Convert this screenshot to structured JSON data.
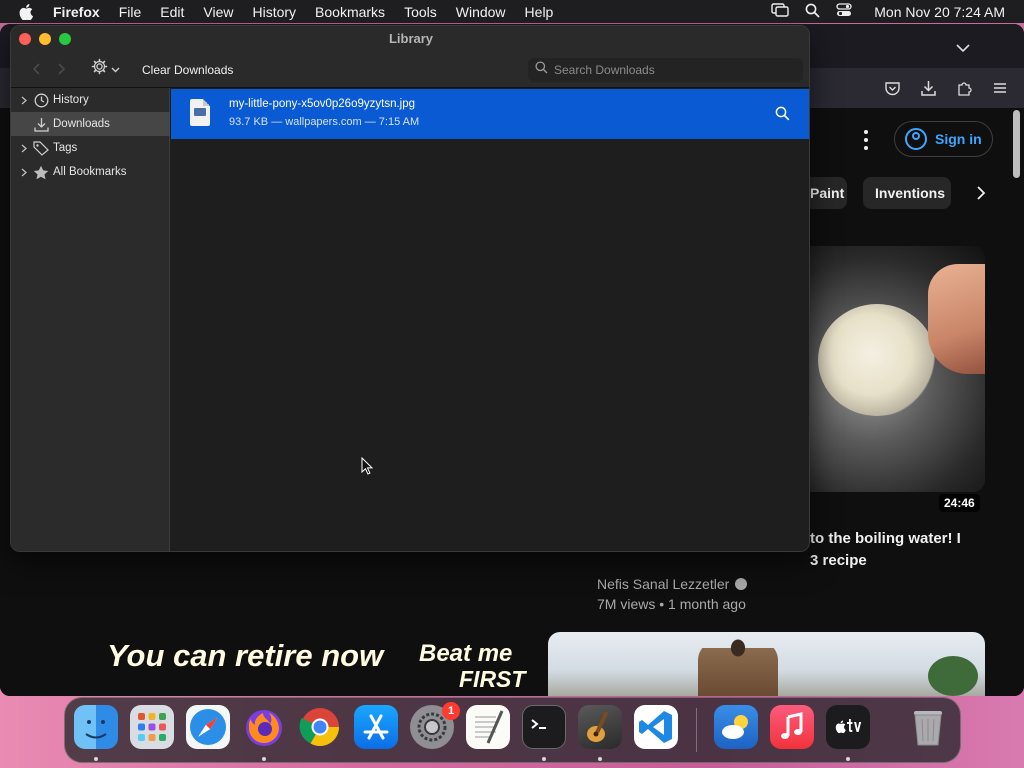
{
  "menubar": {
    "app_name": "Firefox",
    "items": [
      "File",
      "Edit",
      "View",
      "History",
      "Bookmarks",
      "Tools",
      "Window",
      "Help"
    ],
    "clock": "Mon Nov 20  7:24 AM"
  },
  "library": {
    "title": "Library",
    "clear_downloads_label": "Clear Downloads",
    "search_placeholder": "Search Downloads",
    "sidebar": [
      {
        "label": "History",
        "icon": "clock-icon",
        "disclosure": true,
        "selected": false
      },
      {
        "label": "Downloads",
        "icon": "download-icon",
        "disclosure": false,
        "selected": true
      },
      {
        "label": "Tags",
        "icon": "tag-icon",
        "disclosure": true,
        "selected": false
      },
      {
        "label": "All Bookmarks",
        "icon": "star-icon",
        "disclosure": true,
        "selected": false
      }
    ],
    "downloads": [
      {
        "file_name": "my-little-pony-x5ov0p26o9yzytsn.jpg",
        "meta": "93.7 KB — wallpapers.com — 7:15 AM"
      }
    ]
  },
  "browser_background": {
    "sign_in_label": "Sign in",
    "chips": [
      "Paint",
      "Inventions"
    ],
    "video": {
      "duration": "24:46",
      "title": "to the boiling water! I 3 recipe",
      "title_line1": "to the boiling water! I",
      "title_line2": "3 recipe",
      "channel": "Nefis Sanal Lezzetler",
      "stats": "7M views • 1 month ago"
    },
    "thumb_text": {
      "left": "You can retire now",
      "right_line1": "Beat me",
      "right_line2": "FIRST"
    }
  },
  "dock": {
    "apps": [
      "finder-icon",
      "launchpad-icon",
      "safari-icon",
      "firefox-icon",
      "chrome-icon",
      "app-store-icon",
      "system-settings-icon",
      "textedit-icon",
      "terminal-icon",
      "garageband-icon",
      "vscode-icon",
      "weather-icon",
      "music-icon",
      "apple-tv-icon",
      "trash-icon"
    ],
    "settings_badge": "1"
  },
  "colors": {
    "selection_blue": "#0a5bd3",
    "link_blue": "#3ea6ff",
    "traffic_close": "#fe5f57",
    "traffic_min": "#febc2e",
    "traffic_max": "#28c840"
  }
}
